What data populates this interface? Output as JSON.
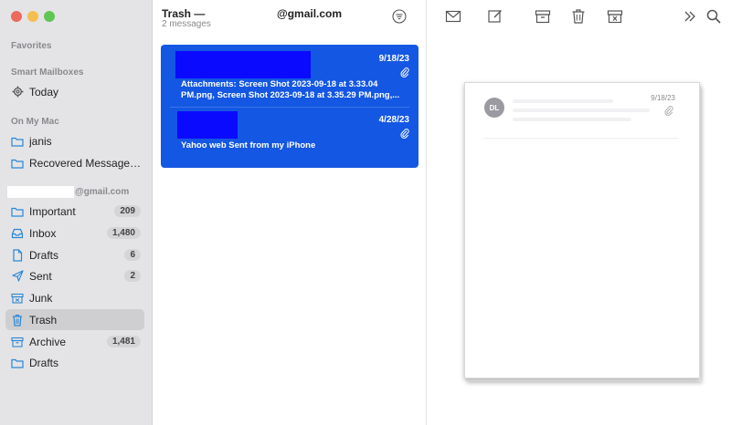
{
  "sidebar": {
    "sections": {
      "favorites": "Favorites",
      "smart": "Smart Mailboxes",
      "onmymac": "On My Mac",
      "account_domain": "@gmail.com"
    },
    "items": [
      {
        "label": "Today",
        "icon": "gear-icon"
      },
      {
        "label": "janis",
        "icon": "folder-icon"
      },
      {
        "label": "Recovered Messages...",
        "icon": "folder-icon"
      },
      {
        "label": "Important",
        "icon": "folder-icon",
        "badge": "209"
      },
      {
        "label": "Inbox",
        "icon": "inbox-icon",
        "badge": "1,480"
      },
      {
        "label": "Drafts",
        "icon": "document-icon",
        "badge": "6"
      },
      {
        "label": "Sent",
        "icon": "paper-plane-icon",
        "badge": "2"
      },
      {
        "label": "Junk",
        "icon": "junk-box-icon"
      },
      {
        "label": "Trash",
        "icon": "trash-icon",
        "selected": true
      },
      {
        "label": "Archive",
        "icon": "archive-box-icon",
        "badge": "1,481"
      },
      {
        "label": "Drafts",
        "icon": "folder-icon"
      }
    ]
  },
  "list": {
    "title": "Trash —",
    "email": "@gmail.com",
    "count": "2 messages",
    "messages": [
      {
        "date": "9/18/23",
        "preview1": "Attachments: Screen Shot 2023-09-18 at 3.33.04",
        "preview2": "PM.png, Screen Shot 2023-09-18 at 3.35.29 PM.png,..."
      },
      {
        "date": "4/28/23",
        "preview1": "Yahoo web Sent from my iPhone"
      }
    ]
  },
  "viewer": {
    "avatar": "DL",
    "date": "9/18/23"
  },
  "colors": {
    "selection": "#1457e2",
    "redaction": "#0a0aff",
    "sidebar_bg": "#e4e4e6"
  }
}
